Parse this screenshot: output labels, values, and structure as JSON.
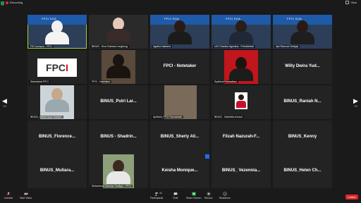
{
  "topbar": {
    "recording": "Recording",
    "view": "View"
  },
  "tiles": {
    "r1c1": {
      "caption": "Fifi Cumayra - FPCI"
    },
    "r1c2": {
      "caption": "BINUS - Diva Clarissa Lengkong"
    },
    "r1c3": {
      "caption": "Agatha Natasha"
    },
    "r1c4": {
      "caption": "UGI Dhanika Agustina - Presidential"
    },
    "r1c5": {
      "caption": "Iqbi Ramzah Setiyaji"
    },
    "r2c1": {
      "caption": "Sekretariat FPCI"
    },
    "r2c2": {
      "caption": "FPCI - Notetaker"
    },
    "r2c3": {
      "name": "FPCI - Notetaker"
    },
    "r2c4": {
      "caption": "Syafrizal Ramadhan"
    },
    "r2c5": {
      "name": "Willy Dwira Yud..."
    },
    "r3c1": {
      "caption": "BINUS_Nabila Nurul Sadilah"
    },
    "r3c2": {
      "name": "BINUS_Putri Lar..."
    },
    "r3c3": {
      "caption": "Apriliani_FPCI Ramdaniah"
    },
    "r3c4": {
      "caption": "BINUS - Gabriella Annaut"
    },
    "r3c5": {
      "name": "BINUS_Raniah N..."
    },
    "r4c1": {
      "name": "BINUS_Florence..."
    },
    "r4c2": {
      "name": "BINUS - Shadrin..."
    },
    "r4c3": {
      "name": "BINUS_Sherly Ali..."
    },
    "r4c4": {
      "name": "Filzah Nazurah-F..."
    },
    "r4c5": {
      "name": "BINUS_Kenny"
    },
    "r5c1": {
      "name": "BINUS_Mutiara..."
    },
    "r5c2": {
      "caption": "Muhammad Mumtaz Taufiqul - FPCI"
    },
    "r5c3": {
      "name": "Keisha Monique..."
    },
    "r5c4": {
      "name": "BINUS_ Vezennia..."
    },
    "r5c5": {
      "name": "BINUS_Helen Ch..."
    }
  },
  "pagination": {
    "left": "1/3",
    "right": "1/3"
  },
  "toolbar": {
    "unmute": "Unmute",
    "start_video": "Start Video",
    "participants": "Participants",
    "participants_count": "41",
    "chat": "Chat",
    "share_screen": "Share Screen",
    "record": "Record",
    "reactions": "Reactions",
    "leave": "Leave"
  },
  "colors": {
    "accent_green": "#9bd33b",
    "leave_red": "#e02828",
    "share_green": "#2fb24c"
  }
}
